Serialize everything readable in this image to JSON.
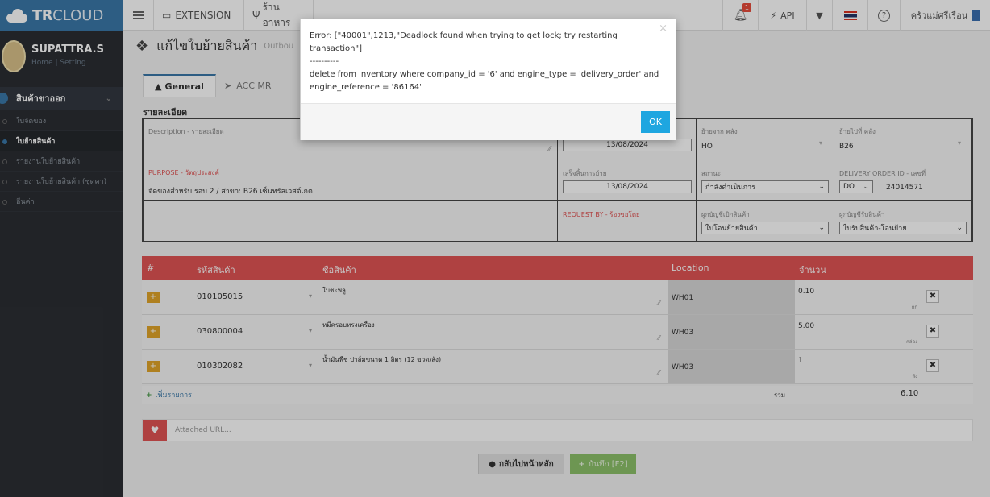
{
  "brand": {
    "bold": "TR",
    "rest": "CLOUD"
  },
  "topnav": {
    "extension": "EXTENSION",
    "restaurant": "ร้านอาหาร",
    "notif_count": "1",
    "api": "API",
    "user": "ครัวแม่ศรีเรือน"
  },
  "profile": {
    "name": "SUPATTRA.S",
    "links": "Home | Setting"
  },
  "sidebar": {
    "section": "สินค้าขาออก",
    "items": [
      "ใบจัดของ",
      "ใบย้ายสินค้า",
      "รายงานใบย้ายสินค้า",
      "รายงานใบย้ายสินค้า (ชุดคา)",
      "อื่นค่า"
    ]
  },
  "page": {
    "title": "แก้ไขใบย้ายสินค้า",
    "subtitle": "Outbou"
  },
  "tabs": [
    "General",
    "ACC MR"
  ],
  "form": {
    "section_label": "รายละเอียด",
    "description_label": "Description - รายละเอียด",
    "purpose_label": "PURPOSE - วัตถุประสงค์",
    "purpose_value": "จัดของสำหรับ รอบ 2 / สาขา: B26 เซ็นทรัลเวสต์เกต",
    "date1": "13/08/2024",
    "date2_label": "เสร็จสิ้นการย้าย",
    "date2": "13/08/2024",
    "request_by_label": "REQUEST BY - ร้องขอโดย",
    "from_wh_label": "ย้ายจาก คลัง",
    "from_wh": "HO",
    "to_wh_label": "ย้ายไปที่ คลัง",
    "to_wh": "B26",
    "status_label": "สถานะ",
    "status": "กำลังดำเนินการ",
    "do_label": "DELIVERY ORDER ID - เลขที่",
    "do_prefix": "DO",
    "do_number": "24014571",
    "acc_out_label": "ผูกบัญชีเบิกสินค้า",
    "acc_out": "ใบโอนย้ายสินค้า",
    "acc_in_label": "ผูกบัญชีรับสินค้า",
    "acc_in": "ใบรับสินค้า-โอนย้าย"
  },
  "table": {
    "headers": [
      "#",
      "รหัสสินค้า",
      "ชื่อสินค้า",
      "Location",
      "จำนวน"
    ],
    "rows": [
      {
        "code": "010105015",
        "name": "ใบชะพลู",
        "location": "WH01",
        "qty": "0.10",
        "unit": "กก"
      },
      {
        "code": "030800004",
        "name": "หมี่ครอบทรงเครื่อง",
        "location": "WH03",
        "qty": "5.00",
        "unit": "กล่อง"
      },
      {
        "code": "010302082",
        "name": "น้ำมันพืช ปาล์มขนาด 1 ลิตร (12 ขวด/ลัง)",
        "location": "WH03",
        "qty": "1",
        "unit": "ลัง"
      }
    ],
    "add_more": "เพิ่มรายการ",
    "total_label": "รวม",
    "total": "6.10"
  },
  "attached_url_placeholder": "Attached URL...",
  "buttons": {
    "back": "กลับไปหน้าหลัก",
    "save": "บันทึก [F2]"
  },
  "modal": {
    "line1": "Error: [\"40001\",1213,\"Deadlock found when trying to get lock; try restarting",
    "line2": "transaction\"]",
    "line3": "----------",
    "line4": "delete from inventory where company_id = '6' and engine_type = 'delivery_order' and",
    "line5": "engine_reference = '86164'",
    "close": "×",
    "ok": "OK"
  }
}
